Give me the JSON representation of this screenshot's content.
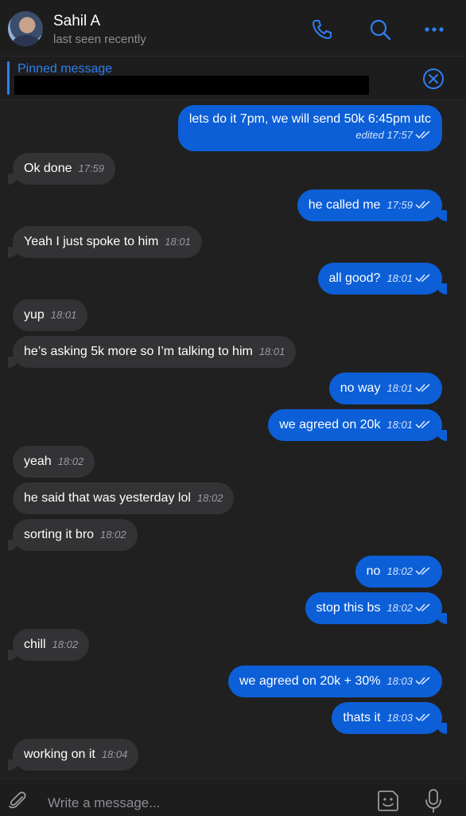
{
  "header": {
    "name": "Sahil A",
    "status": "last seen recently",
    "icons": [
      "phone-icon",
      "search-icon",
      "more-icon"
    ]
  },
  "pinned": {
    "title": "Pinned message"
  },
  "messages": [
    {
      "dir": "out",
      "text": "lets do it 7pm, we will send 50k 6:45pm utc",
      "meta": "edited 17:57"
    },
    {
      "dir": "in",
      "text": "Ok done",
      "time": "17:59"
    },
    {
      "dir": "out",
      "text": "he called me",
      "time": "17:59"
    },
    {
      "dir": "in",
      "text": "Yeah I just spoke to him",
      "time": "18:01"
    },
    {
      "dir": "out",
      "text": "all good?",
      "time": "18:01"
    },
    {
      "dir": "in",
      "text": "yup",
      "time": "18:01"
    },
    {
      "dir": "in",
      "text": "he’s asking 5k more so I’m talking to him",
      "time": "18:01"
    },
    {
      "dir": "out",
      "text": "no way",
      "time": "18:01"
    },
    {
      "dir": "out",
      "text": "we agreed on 20k",
      "time": "18:01"
    },
    {
      "dir": "in",
      "text": "yeah",
      "time": "18:02"
    },
    {
      "dir": "in",
      "text": "he said that was yesterday lol",
      "time": "18:02"
    },
    {
      "dir": "in",
      "text": "sorting it bro",
      "time": "18:02"
    },
    {
      "dir": "out",
      "text": "no",
      "time": "18:02"
    },
    {
      "dir": "out",
      "text": "stop this bs",
      "time": "18:02"
    },
    {
      "dir": "in",
      "text": "chill",
      "time": "18:02"
    },
    {
      "dir": "out",
      "text": "we agreed on 20k + 30%",
      "time": "18:03"
    },
    {
      "dir": "out",
      "text": "thats it",
      "time": "18:03"
    },
    {
      "dir": "in",
      "text": "working on it",
      "time": "18:04"
    }
  ],
  "composer": {
    "placeholder": "Write a message..."
  },
  "colors": {
    "accent": "#2f7ff2",
    "outgoing_bubble": "#0c5fd6",
    "incoming_bubble": "#333335",
    "background": "#202021"
  }
}
